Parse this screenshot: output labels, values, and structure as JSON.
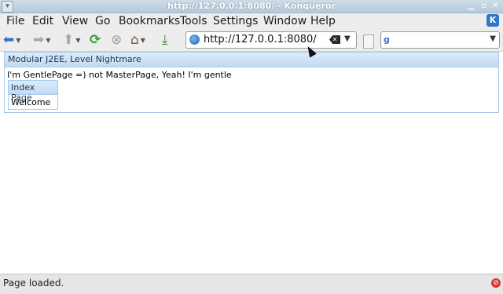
{
  "window": {
    "title": "http://127.0.0.1:8080/ - Konqueror"
  },
  "menu": {
    "items": [
      "File",
      "Edit",
      "View",
      "Go",
      "Bookmarks",
      "Tools",
      "Settings",
      "Window",
      "Help"
    ]
  },
  "toolbar": {
    "url": "http://127.0.0.1:8080/",
    "search_placeholder": ""
  },
  "page": {
    "panel_title": "Modular J2EE, Level Nightmare",
    "message": "I'm GentlePage =) not MasterPage, Yeah! I'm gentle",
    "inner_title": "Index Page",
    "inner_body": "Welcome"
  },
  "status": {
    "text": "Page loaded."
  },
  "icons": {
    "back": "back-arrow-icon",
    "forward": "forward-arrow-icon",
    "up": "up-arrow-icon",
    "reload": "reload-icon",
    "stop": "stop-icon",
    "home": "home-icon",
    "download": "download-icon"
  },
  "colors": {
    "panel_header": "#c3daf1",
    "panel_border": "#a8c8e8",
    "reload": "#2e9e2e"
  }
}
